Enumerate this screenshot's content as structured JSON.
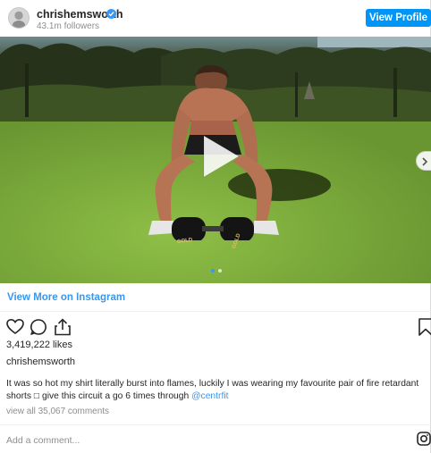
{
  "header": {
    "username": "chrishemsworth",
    "followers": "43.1m followers",
    "view_profile_label": "View Profile",
    "verified_badge": "verified-check-icon",
    "brand_color": "#0095f6"
  },
  "media": {
    "play_icon": "play-icon",
    "next_icon": "chevron-right-icon",
    "carousel_dots_active": 1,
    "carousel_dots_total": 2,
    "dumbbell_left_text": "GOLD",
    "dumbbell_right_text": "GOLD"
  },
  "view_more": "View More on Instagram",
  "actions": {
    "like_icon": "heart-icon",
    "comment_icon": "comment-icon",
    "share_icon": "share-icon",
    "save_icon": "bookmark-icon"
  },
  "likes": "3,419,222 likes",
  "caption": {
    "owner": "chrishemsworth",
    "text": "It was so hot my shirt literally burst into flames, luckily I was wearing my favourite pair of fire retardant shorts □ give this circuit a go 6 times through ",
    "mention": "@centrfit"
  },
  "comments_link": "view all 35,067 comments",
  "add_comment_placeholder": "Add a comment...",
  "instagram_icon": "instagram-logo-icon",
  "link_color": "#3897f0"
}
